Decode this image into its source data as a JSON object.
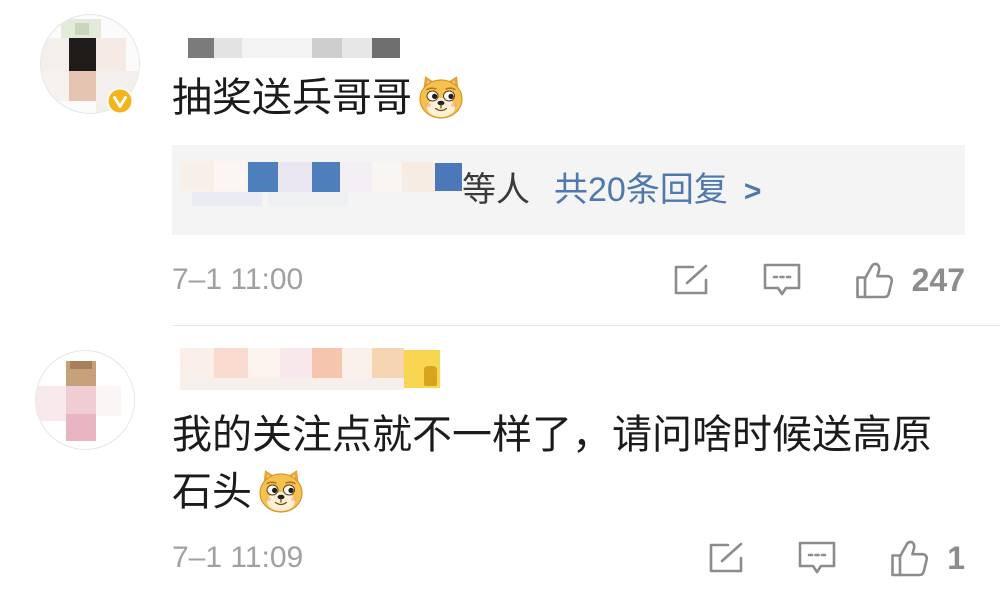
{
  "colors": {
    "text": "#1b1b1b",
    "muted_text": "#a0a0a0",
    "link": "#4f79ad",
    "reply_box_background": "#f4f4f4",
    "icon": "#8c8c8c",
    "verified_badge": "#f4b41c",
    "divider": "#e8e8e8"
  },
  "comments": [
    {
      "avatar_icon": "pixelated-avatar",
      "verified_icon": "verified-badge-icon",
      "username_icon": "pixelated-username",
      "text_lines": [
        "抽奖送兵哥哥"
      ],
      "emoji_icon": "doge-emoji",
      "replies": {
        "names_icon": "pixelated-usernames",
        "suffix": "等人",
        "count_label": "共20条回复",
        "chevron": ">"
      },
      "time": "7–1 11:00",
      "actions": {
        "share_icon": "share-icon",
        "comment_icon": "comment-icon",
        "like_icon": "thumbs-up-icon",
        "like_count": 247
      }
    },
    {
      "avatar_icon": "pixelated-avatar",
      "username_icon": "pixelated-username",
      "text_lines": [
        "我的关注点就不一样了，请问啥时候送高原",
        "石头"
      ],
      "emoji_icon": "doge-emoji",
      "time": "7–1 11:09",
      "actions": {
        "share_icon": "share-icon",
        "comment_icon": "comment-icon",
        "like_icon": "thumbs-up-icon",
        "like_count": 1
      }
    }
  ]
}
